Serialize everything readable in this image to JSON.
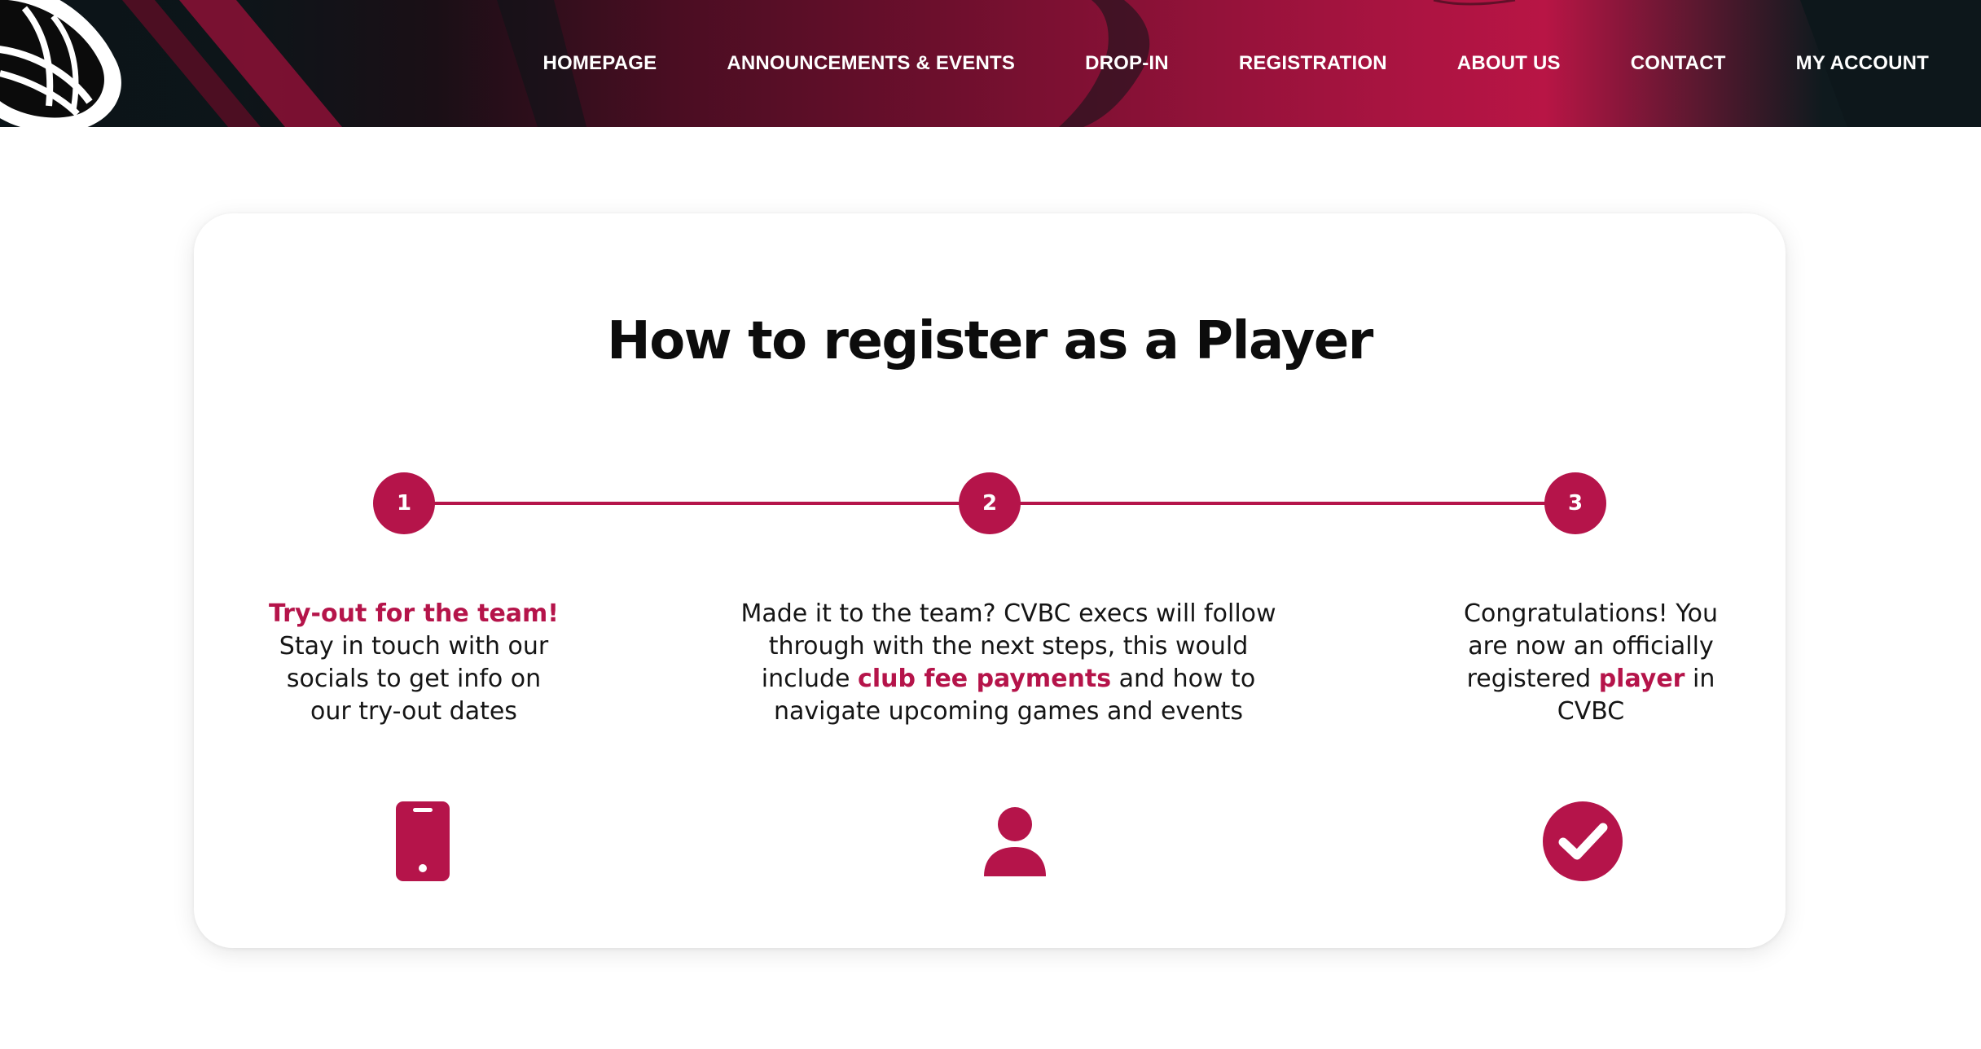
{
  "colors": {
    "accent": "#b5144a",
    "header_dark": "#0b1418",
    "header_red": "#b81545",
    "text": "#151515"
  },
  "header": {
    "logo_icon": "volleyball-wing-logo-icon",
    "nav": [
      {
        "label": "HOMEPAGE"
      },
      {
        "label": "ANNOUNCEMENTS & EVENTS"
      },
      {
        "label": "DROP-IN"
      },
      {
        "label": "REGISTRATION"
      },
      {
        "label": "ABOUT US"
      },
      {
        "label": "CONTACT"
      },
      {
        "label": "MY ACCOUNT"
      }
    ]
  },
  "card": {
    "title": "How to register as a Player",
    "steps": [
      {
        "number": "1",
        "highlight": "Try-out for the team!",
        "text": "Stay in touch with our socials to get info on our try-out dates",
        "icon": "mobile-phone-icon"
      },
      {
        "number": "2",
        "text_before": "Made it to the team? CVBC execs will follow through with the next steps, this would include",
        "highlight": "club fee payments",
        "text_after": "and how to navigate upcoming games and events",
        "icon": "user-icon"
      },
      {
        "number": "3",
        "text_before": "Congratulations! You are now an officially registered",
        "highlight": "player",
        "text_after": "in CVBC",
        "icon": "check-circle-icon"
      }
    ]
  }
}
